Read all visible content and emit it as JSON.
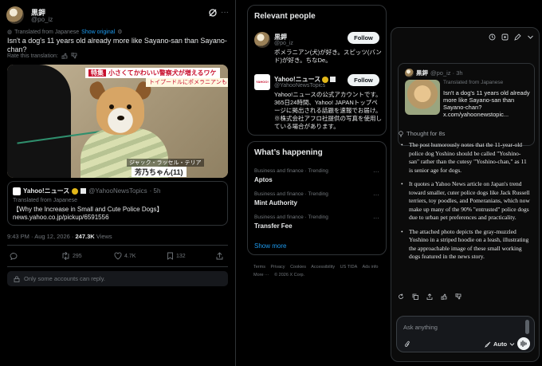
{
  "tweet": {
    "author_name": "黒鉀",
    "author_handle": "@po_iz",
    "translated_label": "Translated from Japanese",
    "show_original": "Show original",
    "text": "Isn't a dog's 11 years old already more like Sayano-san than Sayano-chan?",
    "rate_label": "Rate this translation:",
    "media": {
      "banner_tag": "特集",
      "banner_main": "小さくてかわいい警察犬が増えるワケ",
      "banner_sub": "トイプードルにポメラニアンも",
      "caption_small": "ジャック・ラッセル・テリア",
      "caption_name": "芳乃ちゃん(11)"
    },
    "quote": {
      "name": "Yahoo!ニュース",
      "handle": "@YahooNewsTopics",
      "time": "· 5h",
      "translated_label": "Translated from Japanese",
      "text": "【Why the Increase in Small and Cute Police Dogs】news.yahoo.co.jp/pickup/6591556"
    },
    "meta": {
      "time": "9:43 PM",
      "date": "· Aug 12, 2026 ·",
      "views": "247.3K",
      "views_label": "Views"
    },
    "actions": {
      "retweets": "295",
      "likes": "4.7K",
      "bookmarks": "132"
    },
    "reply_restriction": "Only some accounts can reply."
  },
  "relevant": {
    "title": "Relevant people",
    "people": [
      {
        "name": "黒鉀",
        "handle": "@po_iz",
        "bio": "ポメラニアン(犬)が好き。スピッツ(バンド)が好き。ちなDe。",
        "follow": "Follow"
      },
      {
        "name": "Yahoo!ニュース",
        "handle": "@YahooNewsTopics",
        "bio": "Yahoo!ニュースの公式アカウントです。365日24時間、Yahoo! JAPANトップページに掲出される話題を速報でお届け。※株式会社アフロ社提供の写真を使用している場合があります。",
        "follow": "Follow",
        "avatar_text": "YAHOO!"
      }
    ]
  },
  "happening": {
    "title": "What’s happening",
    "trends": [
      {
        "category": "Business and finance · Trending",
        "name": "Aptos"
      },
      {
        "category": "Business and finance · Trending",
        "name": "Mint Authority"
      },
      {
        "category": "Business and finance · Trending",
        "name": "Transfer Fee"
      }
    ],
    "show_more": "Show more"
  },
  "footer": {
    "links": [
      "Terms",
      "Privacy",
      "Cookies",
      "Accessibility",
      "US TIDA",
      "Ads info",
      "More ···",
      "© 2026 X Corp."
    ]
  },
  "grok": {
    "card": {
      "name": "黒鉀",
      "handle": "@po_iz · 3h",
      "translated_label": "Translated from Japanese",
      "text": "Isn't a dog's 11 years old already more like Sayano-san than Sayano-chan? x.com/yahoonewstopic..."
    },
    "thought": "Thought for 8s",
    "answer": [
      "The post humorously notes that the 11-year-old police dog Yoshino should be called \"Yoshino-san\" rather than the cutesy \"Yoshino-chan,\" as 11 is senior age for dogs.",
      "It quotes a Yahoo News article on Japan's trend toward smaller, cuter police dogs like Jack Russell terriers, toy poodles, and Pomeranians, which now make up many of the 90% \"entrusted\" police dogs due to urban pet preferences and practicality.",
      "The attached photo depicts the gray-muzzled Yoshino in a striped hoodie on a leash, illustrating the approachable image of these small working dogs featured in the news story."
    ],
    "input_placeholder": "Ask anything",
    "mode": "Auto"
  }
}
